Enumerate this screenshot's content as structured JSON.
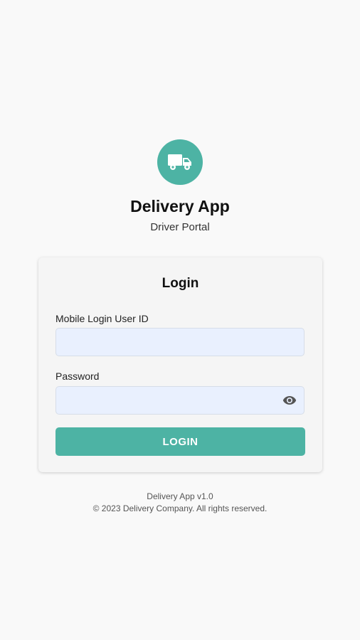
{
  "app": {
    "title": "Delivery App",
    "subtitle": "Driver Portal",
    "logo_icon": "delivery-truck-icon",
    "accent_color": "#4db3a4"
  },
  "login": {
    "title": "Login",
    "user_id_label": "Mobile Login User ID",
    "user_id_value": "",
    "password_label": "Password",
    "password_value": "",
    "password_toggle_icon": "eye-icon",
    "submit_label": "LOGIN"
  },
  "footer": {
    "version": "Delivery App v1.0",
    "copyright": "© 2023 Delivery Company. All rights reserved."
  }
}
